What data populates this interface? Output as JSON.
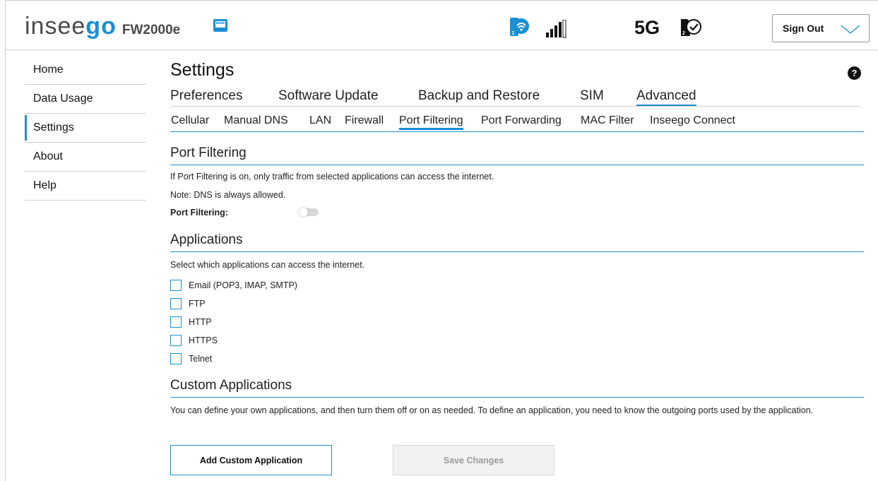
{
  "header": {
    "logo_part1": "inse",
    "logo_part2": "go",
    "model": "FW2000e",
    "network_label": "5G",
    "sign_out_label": "Sign Out",
    "accent_color": "#1b8fd3",
    "hotspot_badge": "1",
    "sim_badge": "2",
    "icons": [
      "ethernet-icon",
      "wifi-hotspot-icon",
      "signal-bars-icon",
      "sim-check-icon",
      "chevron-down-icon"
    ]
  },
  "sidebar": {
    "items": [
      {
        "label": "Home"
      },
      {
        "label": "Data Usage"
      },
      {
        "label": "Settings",
        "active": true
      },
      {
        "label": "About"
      },
      {
        "label": "Help"
      }
    ]
  },
  "main": {
    "title": "Settings",
    "help_glyph": "?",
    "tabs": [
      {
        "label": "Preferences"
      },
      {
        "label": "Software Update"
      },
      {
        "label": "Backup and Restore"
      },
      {
        "label": "SIM"
      },
      {
        "label": "Advanced",
        "active": true
      }
    ],
    "subtabs": [
      {
        "label": "Cellular"
      },
      {
        "label": "Manual DNS"
      },
      {
        "label": "LAN"
      },
      {
        "label": "Firewall"
      },
      {
        "label": "Port Filtering",
        "active": true
      },
      {
        "label": "Port Forwarding"
      },
      {
        "label": "MAC Filter"
      },
      {
        "label": "Inseego Connect"
      }
    ],
    "port_filtering": {
      "title": "Port Filtering",
      "description": "If Port Filtering is on, only traffic from selected applications can access the internet.",
      "note": "Note: DNS is always allowed.",
      "toggle_label": "Port Filtering:",
      "toggle_on": false
    },
    "applications": {
      "title": "Applications",
      "description": "Select which applications can access the internet.",
      "items": [
        {
          "label": "Email (POP3, IMAP, SMTP)",
          "checked": false
        },
        {
          "label": "FTP",
          "checked": false
        },
        {
          "label": "HTTP",
          "checked": false
        },
        {
          "label": "HTTPS",
          "checked": false
        },
        {
          "label": "Telnet",
          "checked": false
        }
      ]
    },
    "custom_applications": {
      "title": "Custom Applications",
      "description": "You can define your own applications, and then turn them off or on as needed. To define an application, you need to know the outgoing ports used by the application.",
      "add_button_label": "Add Custom Application",
      "save_button_label": "Save Changes"
    }
  }
}
